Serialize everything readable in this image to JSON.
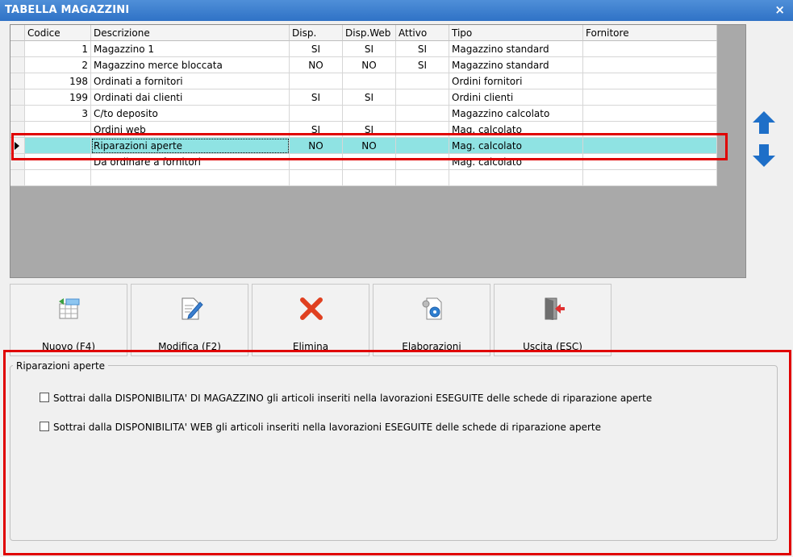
{
  "window": {
    "title": "TABELLA MAGAZZINI",
    "close_glyph": "×",
    "close_icon": "close-icon"
  },
  "grid": {
    "columns": [
      "Codice",
      "Descrizione",
      "Disp.",
      "Disp.Web",
      "Attivo",
      "Tipo",
      "Fornitore"
    ],
    "rows": [
      {
        "codice": "1",
        "descrizione": "Magazzino 1",
        "disp": "SI",
        "dispweb": "SI",
        "attivo": "SI",
        "tipo": "Magazzino standard",
        "fornitore": ""
      },
      {
        "codice": "2",
        "descrizione": "Magazzino merce bloccata",
        "disp": "NO",
        "dispweb": "NO",
        "attivo": "SI",
        "tipo": "Magazzino standard",
        "fornitore": ""
      },
      {
        "codice": "198",
        "descrizione": "Ordinati a fornitori",
        "disp": "",
        "dispweb": "",
        "attivo": "",
        "tipo": "Ordini fornitori",
        "fornitore": ""
      },
      {
        "codice": "199",
        "descrizione": "Ordinati dai clienti",
        "disp": "SI",
        "dispweb": "SI",
        "attivo": "",
        "tipo": "Ordini clienti",
        "fornitore": ""
      },
      {
        "codice": "3",
        "descrizione": "C/to deposito",
        "disp": "",
        "dispweb": "",
        "attivo": "",
        "tipo": "Magazzino calcolato",
        "fornitore": ""
      },
      {
        "codice": "",
        "descrizione": "Ordini web",
        "disp": "SI",
        "dispweb": "SI",
        "attivo": "",
        "tipo": "Mag. calcolato",
        "fornitore": ""
      },
      {
        "codice": "",
        "descrizione": "Riparazioni aperte",
        "disp": "NO",
        "dispweb": "NO",
        "attivo": "",
        "tipo": "Mag. calcolato",
        "fornitore": "",
        "selected": true
      },
      {
        "codice": "",
        "descrizione": "Da ordinare a fornitori",
        "disp": "",
        "dispweb": "",
        "attivo": "",
        "tipo": "Mag. calcolato",
        "fornitore": ""
      },
      {
        "codice": "",
        "descrizione": "",
        "disp": "",
        "dispweb": "",
        "attivo": "",
        "tipo": "",
        "fornitore": ""
      }
    ]
  },
  "side_buttons": {
    "up_icon": "arrow-up-icon",
    "down_icon": "arrow-down-icon",
    "color": "#1e6fc8"
  },
  "toolbar": {
    "buttons": [
      {
        "label": "Nuovo (F4)",
        "icon": "new-record-icon"
      },
      {
        "label": "Modifica (F2)",
        "icon": "edit-icon"
      },
      {
        "label": "Elimina",
        "icon": "delete-icon"
      },
      {
        "label": "Elaborazioni",
        "icon": "process-icon"
      },
      {
        "label": "Uscita (ESC)",
        "icon": "exit-icon"
      }
    ]
  },
  "options": {
    "group_title": "Riparazioni aperte",
    "checkboxes": [
      {
        "label": "Sottrai dalla DISPONIBILITA' DI MAGAZZINO gli articoli inseriti nella lavorazioni ESEGUITE delle schede di riparazione aperte",
        "checked": false
      },
      {
        "label": "Sottrai dalla DISPONIBILITA' WEB gli articoli inseriti nella lavorazioni ESEGUITE delle schede di riparazione aperte",
        "checked": false
      }
    ]
  },
  "colors": {
    "titlebar": "#3a7ccc",
    "selection": "#8fe3e3",
    "highlight_box": "#e00000",
    "delete_icon": "#e04020"
  }
}
